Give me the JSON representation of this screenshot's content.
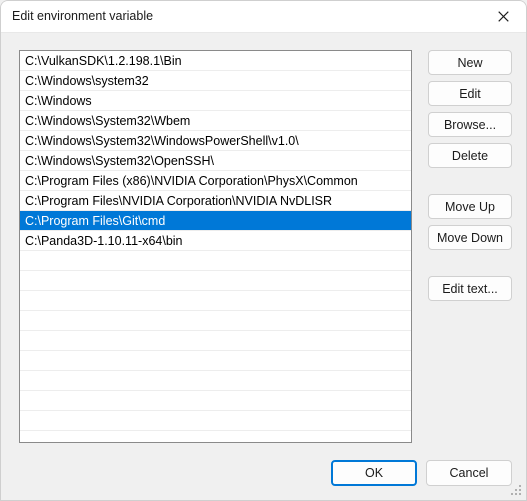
{
  "window": {
    "title": "Edit environment variable",
    "close_icon": "close-icon"
  },
  "list": {
    "selected_index": 8,
    "items": [
      "C:\\VulkanSDK\\1.2.198.1\\Bin",
      "C:\\Windows\\system32",
      "C:\\Windows",
      "C:\\Windows\\System32\\Wbem",
      "C:\\Windows\\System32\\WindowsPowerShell\\v1.0\\",
      "C:\\Windows\\System32\\OpenSSH\\",
      "C:\\Program Files (x86)\\NVIDIA Corporation\\PhysX\\Common",
      "C:\\Program Files\\NVIDIA Corporation\\NVIDIA NvDLISR",
      "C:\\Program Files\\Git\\cmd",
      "C:\\Panda3D-1.10.11-x64\\bin"
    ],
    "empty_row_count": 9
  },
  "side_buttons": [
    {
      "label": "New",
      "name": "new-button",
      "gap_after": false
    },
    {
      "label": "Edit",
      "name": "edit-button",
      "gap_after": false
    },
    {
      "label": "Browse...",
      "name": "browse-button",
      "gap_after": false
    },
    {
      "label": "Delete",
      "name": "delete-button",
      "gap_after": true
    },
    {
      "label": "Move Up",
      "name": "move-up-button",
      "gap_after": false
    },
    {
      "label": "Move Down",
      "name": "move-down-button",
      "gap_after": true
    },
    {
      "label": "Edit text...",
      "name": "edit-text-button",
      "gap_after": false
    }
  ],
  "bottom_buttons": {
    "ok_label": "OK",
    "cancel_label": "Cancel"
  },
  "colors": {
    "selection": "#0078d7",
    "dialog_background": "#f0f0f0",
    "list_background": "#ffffff",
    "accent_border": "#0078d7"
  }
}
